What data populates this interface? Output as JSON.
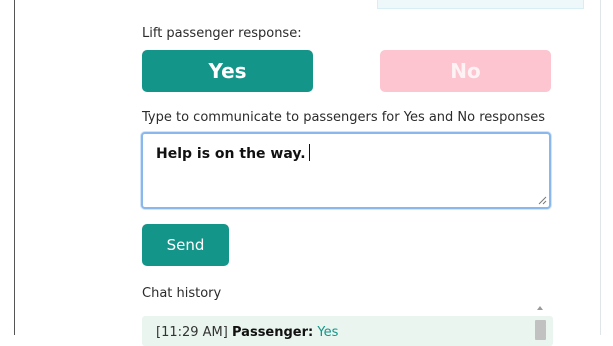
{
  "response_section": {
    "label": "Lift passenger response:",
    "yes_label": "Yes",
    "no_label": "No"
  },
  "message_section": {
    "label": "Type to communicate to passengers for Yes and No responses",
    "value": "Help is on the way."
  },
  "send_label": "Send",
  "chat": {
    "label": "Chat history",
    "entries": [
      {
        "time": "[11:29 AM]",
        "sender": "Passenger:",
        "text": "Yes"
      }
    ]
  },
  "colors": {
    "accent": "#14958a",
    "no_button": "#fcc5d0",
    "focus_border": "#8ab7ec",
    "chat_bg": "#e9f5ee"
  },
  "icons": [
    "resize-grip-icon",
    "scroll-up-arrow-icon"
  ]
}
